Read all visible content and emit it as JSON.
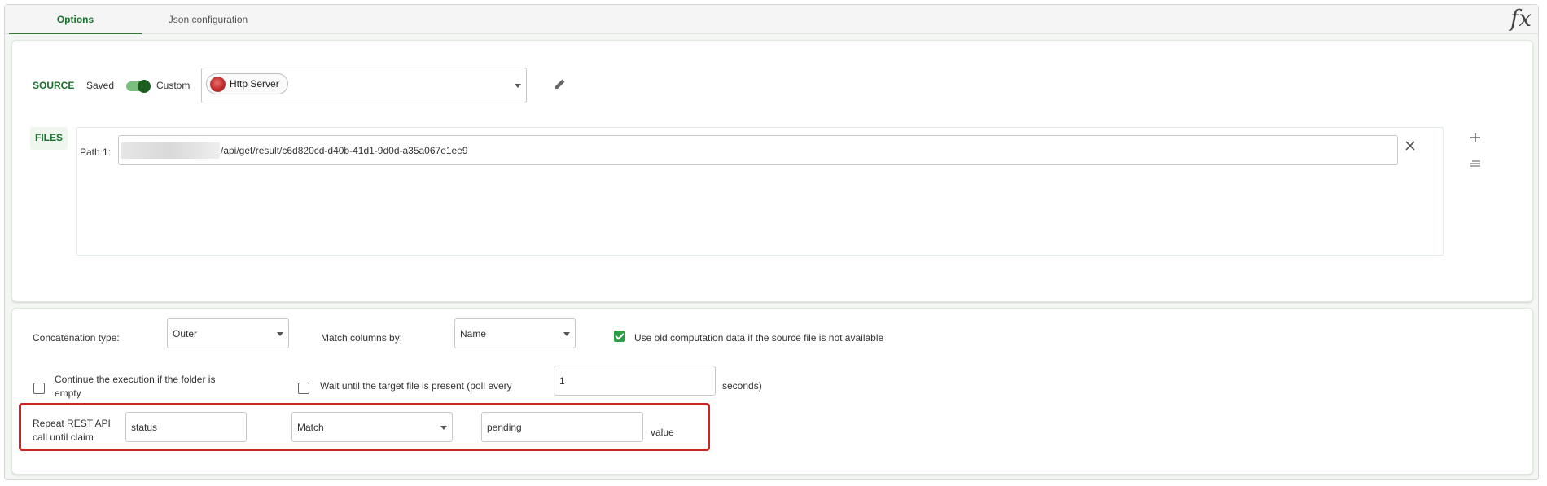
{
  "tabs": [
    {
      "label": "Options",
      "active": true
    },
    {
      "label": "Json configuration",
      "active": false
    }
  ],
  "fx_label": "fx",
  "source": {
    "label": "SOURCE",
    "saved_label": "Saved",
    "custom_label": "Custom",
    "toggle_on": true,
    "selected_source": "Http Server",
    "edit_icon": "pencil-icon"
  },
  "files": {
    "label": "FILES",
    "path_label": "Path 1:",
    "path_value": "/api/get/result/c6d820cd-d40b-41d1-9d0d-a35a067e1ee9",
    "clear_icon": "close-icon",
    "add_icon": "plus-icon",
    "menu_icon": "lines-icon"
  },
  "options": {
    "concat_label": "Concatenation type:",
    "concat_value": "Outer",
    "match_label": "Match columns by:",
    "match_value": "Name",
    "use_old_label": "Use old computation data if the source file is not available",
    "use_old_checked": true,
    "continue_label_1": "Continue the execution if the folder is",
    "continue_label_2": "empty",
    "continue_checked": false,
    "wait_label": "Wait until the target file is present (poll every",
    "wait_checked": false,
    "poll_value": "1",
    "seconds_label": "seconds)"
  },
  "repeat": {
    "label_1": "Repeat REST API",
    "label_2": "call until claim",
    "claim_value": "status",
    "operator_value": "Match",
    "target_value": "pending",
    "value_label": "value"
  },
  "colors": {
    "accent": "#1b6f2e",
    "highlight": "#c62828",
    "checkbox": "#2e9d46"
  }
}
